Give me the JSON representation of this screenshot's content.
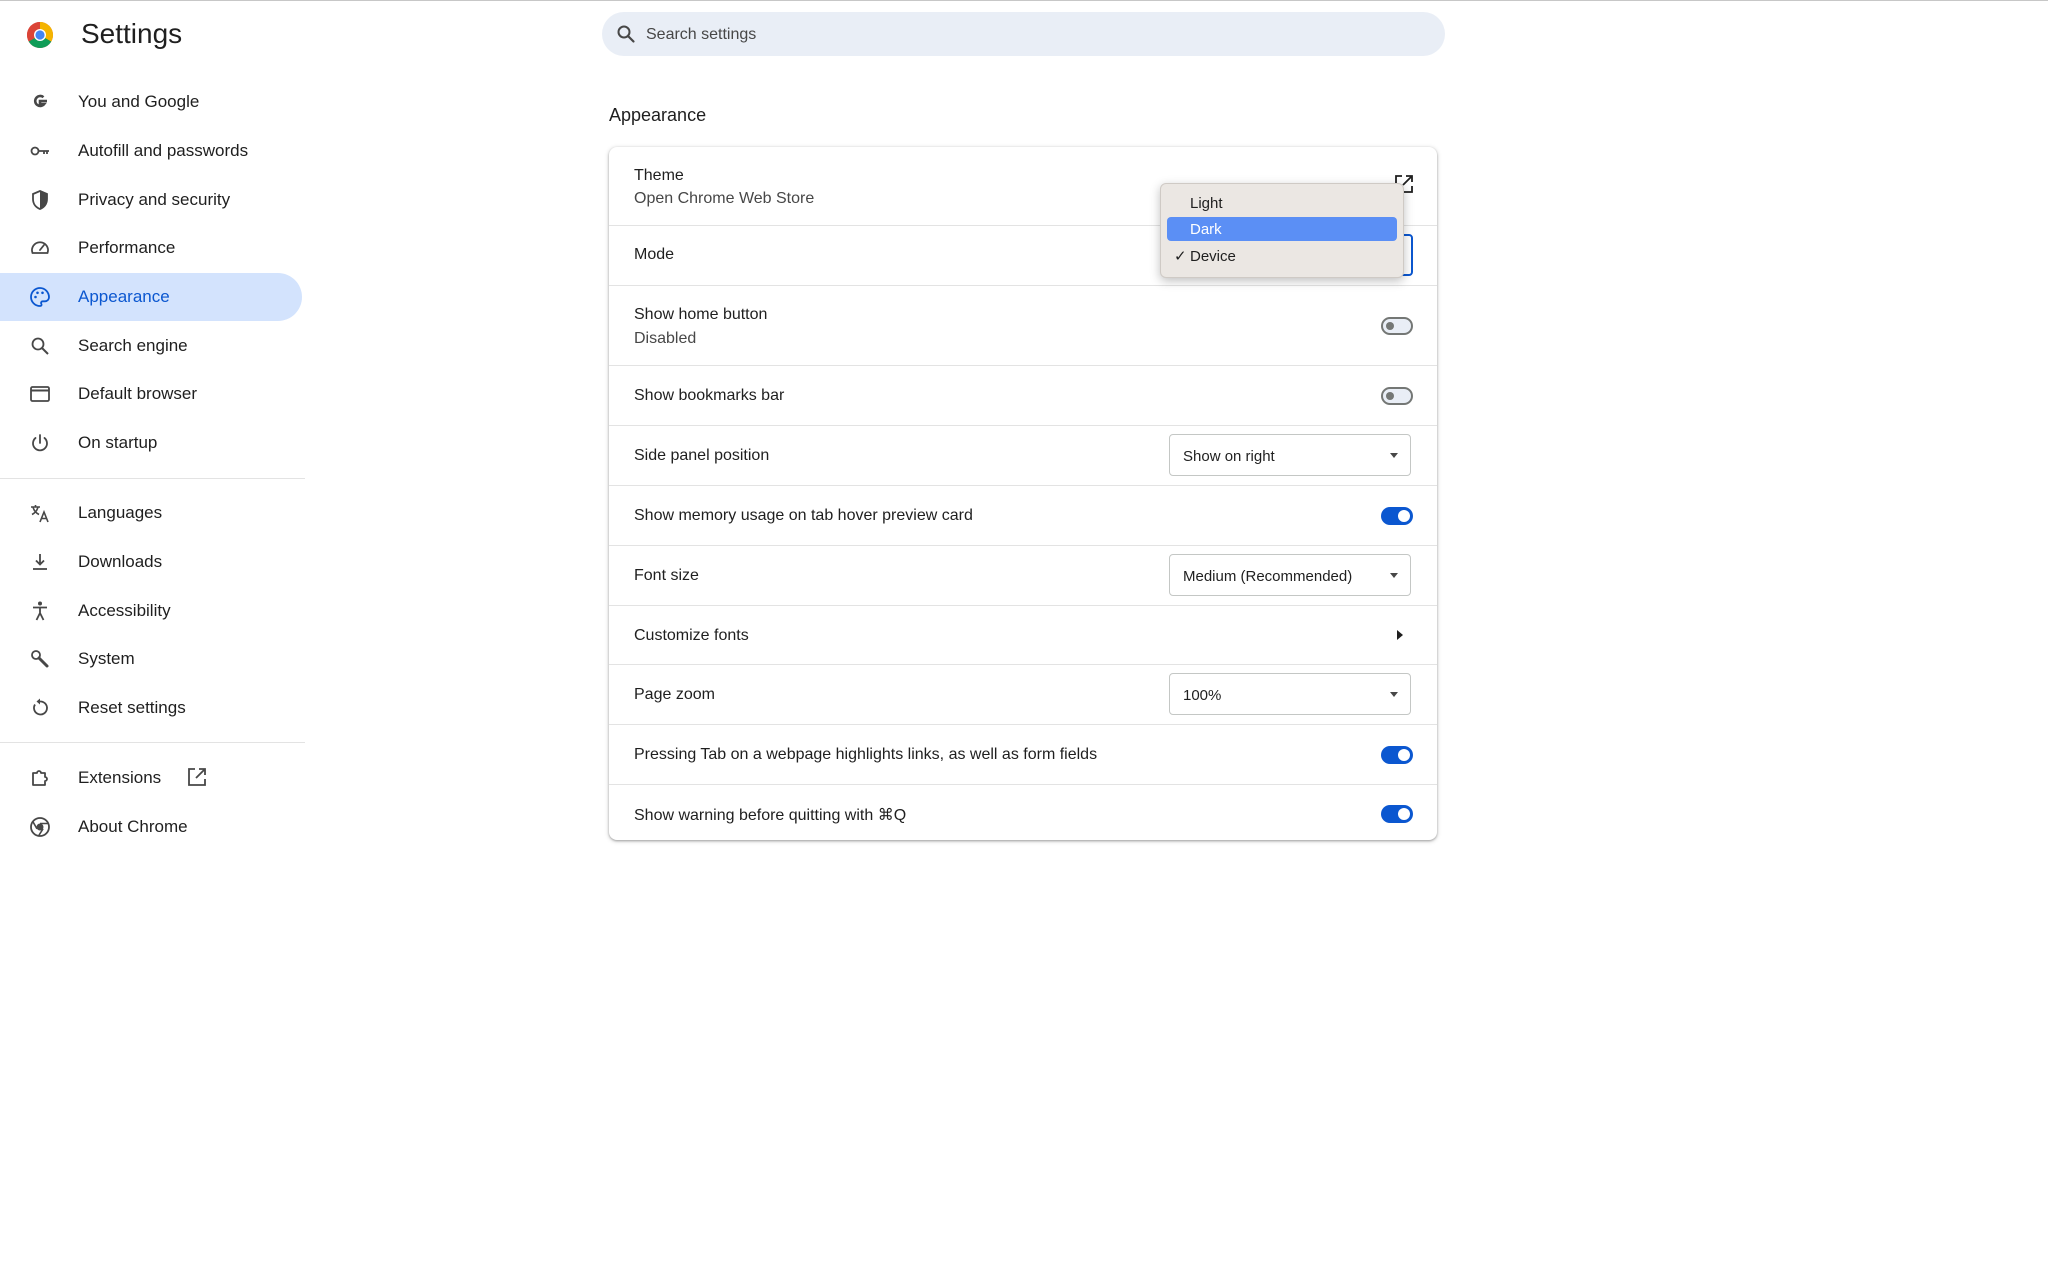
{
  "app": {
    "title": "Settings"
  },
  "search": {
    "placeholder": "Search settings"
  },
  "sidebar": {
    "items": [
      {
        "label": "You and Google"
      },
      {
        "label": "Autofill and passwords"
      },
      {
        "label": "Privacy and security"
      },
      {
        "label": "Performance"
      },
      {
        "label": "Appearance"
      },
      {
        "label": "Search engine"
      },
      {
        "label": "Default browser"
      },
      {
        "label": "On startup"
      },
      {
        "label": "Languages"
      },
      {
        "label": "Downloads"
      },
      {
        "label": "Accessibility"
      },
      {
        "label": "System"
      },
      {
        "label": "Reset settings"
      },
      {
        "label": "Extensions"
      },
      {
        "label": "About Chrome"
      }
    ],
    "active": "Appearance"
  },
  "section": {
    "title": "Appearance",
    "theme": {
      "label": "Theme",
      "sub": "Open Chrome Web Store"
    },
    "mode": {
      "label": "Mode",
      "options": [
        "Light",
        "Dark",
        "Device"
      ],
      "selected": "Device",
      "highlighted": "Dark"
    },
    "home_button": {
      "label": "Show home button",
      "sub": "Disabled",
      "enabled": false
    },
    "bookmarks_bar": {
      "label": "Show bookmarks bar",
      "enabled": false
    },
    "side_panel": {
      "label": "Side panel position",
      "value": "Show on right"
    },
    "memory_usage": {
      "label": "Show memory usage on tab hover preview card",
      "enabled": true
    },
    "font_size": {
      "label": "Font size",
      "value": "Medium (Recommended)"
    },
    "customize_fonts": {
      "label": "Customize fonts"
    },
    "page_zoom": {
      "label": "Page zoom",
      "value": "100%"
    },
    "tab_highlights": {
      "label": "Pressing Tab on a webpage highlights links, as well as form fields",
      "enabled": true
    },
    "warn_quit": {
      "label": "Show warning before quitting with ⌘Q",
      "enabled": true
    }
  },
  "colors": {
    "accent": "#0b57d0",
    "active_bg": "#d3e3fd",
    "search_bg": "#e9eef6",
    "menu_highlight": "#5b8ff5"
  }
}
